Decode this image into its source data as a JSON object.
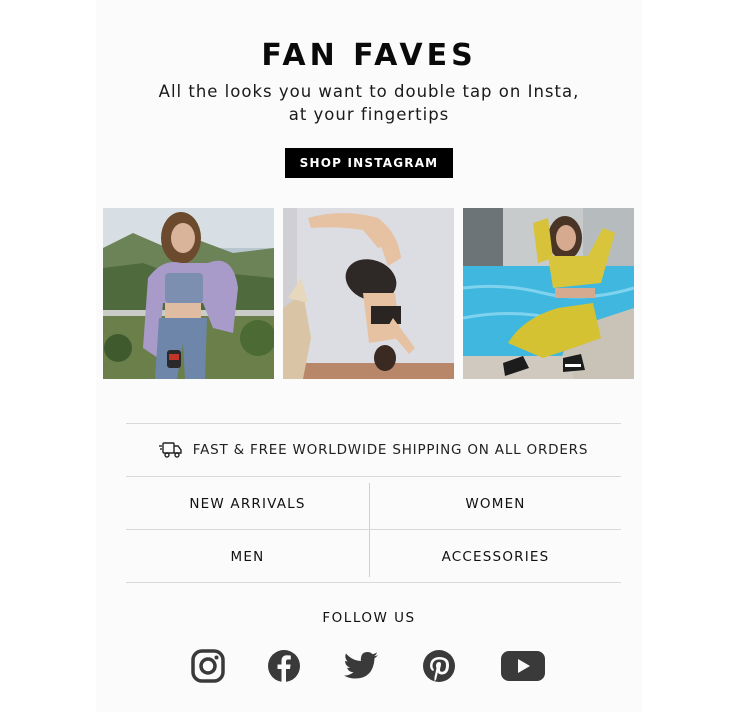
{
  "hero": {
    "title": "FAN FAVES",
    "subtitle_line1": "All the looks you want to double tap on Insta,",
    "subtitle_line2": "at your fingertips",
    "button_label": "SHOP INSTAGRAM"
  },
  "photos": [
    {
      "icon": "woman-mountain-photo"
    },
    {
      "icon": "woman-headstand-photo"
    },
    {
      "icon": "woman-pool-photo"
    }
  ],
  "shipping": {
    "icon": "delivery-truck-icon",
    "text": "FAST & FREE WORLDWIDE SHIPPING ON ALL ORDERS"
  },
  "nav": {
    "items": [
      {
        "label": "NEW ARRIVALS"
      },
      {
        "label": "WOMEN"
      },
      {
        "label": "MEN"
      },
      {
        "label": "ACCESSORIES"
      }
    ]
  },
  "follow": {
    "label": "FOLLOW US",
    "icons": [
      "instagram-icon",
      "facebook-icon",
      "twitter-icon",
      "pinterest-icon",
      "youtube-icon"
    ],
    "icon_color": "#3a3a3a"
  },
  "colors": {
    "button_bg": "#000000",
    "button_text": "#ffffff",
    "divider": "#d9d9d9"
  }
}
